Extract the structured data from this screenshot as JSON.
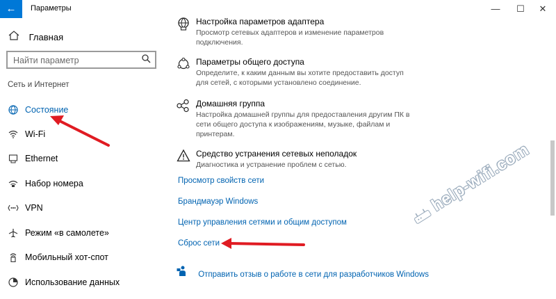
{
  "window": {
    "title": "Параметры",
    "minimize_glyph": "—",
    "maximize_glyph": "☐",
    "close_glyph": "✕",
    "back_glyph": "←",
    "accent_color": "#0078d7"
  },
  "sidebar": {
    "home_label": "Главная",
    "search_placeholder": "Найти параметр",
    "section_label": "Сеть и Интернет",
    "items": [
      {
        "label": "Состояние",
        "icon": "globe-icon",
        "active": true
      },
      {
        "label": "Wi-Fi",
        "icon": "wifi-icon",
        "active": false
      },
      {
        "label": "Ethernet",
        "icon": "ethernet-icon",
        "active": false
      },
      {
        "label": "Набор номера",
        "icon": "dialup-icon",
        "active": false
      },
      {
        "label": "VPN",
        "icon": "vpn-icon",
        "active": false
      },
      {
        "label": "Режим «в самолете»",
        "icon": "airplane-icon",
        "active": false
      },
      {
        "label": "Мобильный хот-спот",
        "icon": "hotspot-icon",
        "active": false
      },
      {
        "label": "Использование данных",
        "icon": "data-usage-icon",
        "active": false
      }
    ]
  },
  "main": {
    "settings": [
      {
        "title": "Настройка параметров адаптера",
        "description": "Просмотр сетевых адаптеров и изменение параметров подключения.",
        "icon": "adapter-icon"
      },
      {
        "title": "Параметры общего доступа",
        "description": "Определите, к каким данным вы хотите предоставить доступ для сетей, с которыми установлено соединение.",
        "icon": "sharing-icon"
      },
      {
        "title": "Домашняя группа",
        "description": "Настройка домашней группы для предоставления другим ПК в сети общего доступа к изображениям, музыке, файлам и принтерам.",
        "icon": "homegroup-icon"
      },
      {
        "title": "Средство устранения сетевых неполадок",
        "description": "Диагностика и устранение проблем с сетью.",
        "icon": "warning-icon"
      }
    ],
    "links": [
      "Просмотр свойств сети",
      "Брандмауэр Windows",
      "Центр управления сетями и общим доступом",
      "Сброс сети"
    ],
    "feedback_label": "Отправить отзыв о работе в сети для разработчиков Windows"
  },
  "watermark": "help-wifi.com"
}
